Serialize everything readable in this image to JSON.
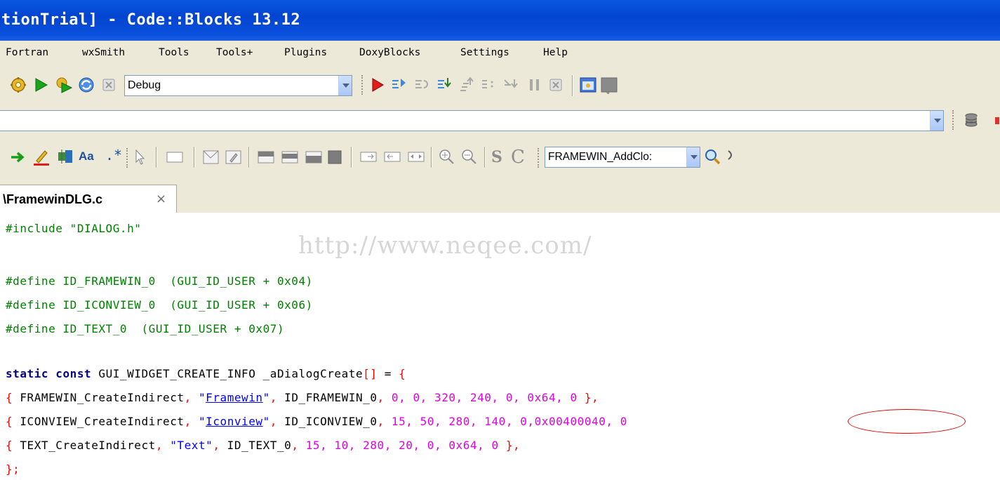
{
  "window": {
    "title": "tionTrial] - Code::Blocks 13.12"
  },
  "menubar": {
    "items": [
      "Fortran",
      "wxSmith",
      "Tools",
      "Tools+",
      "Plugins",
      "DoxyBlocks",
      "Settings",
      "Help"
    ]
  },
  "toolbar1": {
    "build_target": "Debug"
  },
  "toolbar2": {
    "combo_value": ""
  },
  "toolbar3": {
    "function_combo": "FRAMEWIN_AddClo:"
  },
  "editor": {
    "tab_label": "\\FramewinDLG.c",
    "tab_close": "×",
    "watermark": "http://www.neqee.com/"
  },
  "code": {
    "l1": "#include \"DIALOG.h\"",
    "l2": "#define ID_FRAMEWIN_0  (GUI_ID_USER + 0x04)",
    "l3": "#define ID_ICONVIEW_0  (GUI_ID_USER + 0x06)",
    "l4": "#define ID_TEXT_0  (GUI_ID_USER + 0x07)",
    "l5": {
      "kw1": "static",
      "kw2": "const",
      "rest": " GUI_WIDGET_CREATE_INFO _aDialogCreate",
      "brackets": "[]",
      "eq": " = ",
      "brace": "{"
    },
    "l6": {
      "open": "{",
      "fn": " FRAMEWIN_CreateIndirect",
      "c1": ",",
      "q1": " \"",
      "str": "Framewin",
      "q2": "\"",
      "c2": ",",
      "id": " ID_FRAMEWIN_0",
      "c3": ",",
      "nums": " 0, 0, 320, 240, 0, 0x64, 0 ",
      "close": "},"
    },
    "l7": {
      "open": "{",
      "fn": " ICONVIEW_CreateIndirect",
      "c1": ",",
      "q1": " \"",
      "str": "Iconview",
      "q2": "\"",
      "c2": ",",
      "id": " ID_ICONVIEW_0",
      "c3": ",",
      "nums": " 15, 50, 280, 140, 0,",
      "hex": "0x00400040",
      "tail": ", 0"
    },
    "l8": {
      "open": "{",
      "fn": " TEXT_CreateIndirect",
      "c1": ",",
      "str": " \"Text\"",
      "c2": ",",
      "id": " ID_TEXT_0",
      "c3": ",",
      "nums": " 15, 10, 280, 20, 0, 0x64, 0 ",
      "close": "},"
    },
    "l9": "};"
  }
}
